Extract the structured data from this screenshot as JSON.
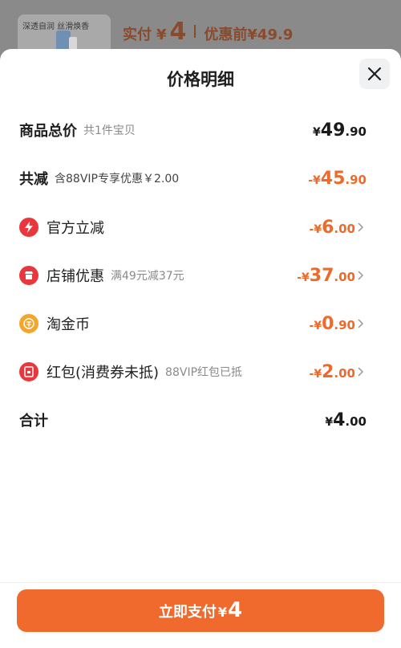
{
  "product": {
    "thumb_caption": "深透自润 丝滑焕香"
  },
  "summary": {
    "paid_label": "实付",
    "currency": "¥",
    "paid_amount": "4",
    "original_label": "优惠前",
    "original_amount": "¥49.9"
  },
  "sheet": {
    "title": "价格明细"
  },
  "rows": [
    {
      "label": "商品总价",
      "sub": "共1件宝贝",
      "amount_prefix": "¥",
      "amount_int": "49",
      "amount_dec": ".90"
    },
    {
      "label": "共减",
      "sub": "含88VIP专享优惠￥2.00",
      "amount_prefix": "-¥",
      "amount_int": "45",
      "amount_dec": ".90"
    },
    {
      "label": "官方立减",
      "sub": "",
      "amount_prefix": "-¥",
      "amount_int": "6",
      "amount_dec": ".00",
      "icon": "lightning-icon",
      "icon_color": "#e8383d"
    },
    {
      "label": "店铺优惠",
      "sub": "满49元减37元",
      "amount_prefix": "-¥",
      "amount_int": "37",
      "amount_dec": ".00",
      "icon": "shop-icon",
      "icon_color": "#e8383d"
    },
    {
      "label": "淘金币",
      "sub": "",
      "amount_prefix": "-¥",
      "amount_int": "0",
      "amount_dec": ".90",
      "icon": "coin-icon",
      "icon_color": "#f4a62a"
    },
    {
      "label": "红包(消费券未抵)",
      "sub": "88VIP红包已抵",
      "amount_prefix": "-¥",
      "amount_int": "2",
      "amount_dec": ".00",
      "icon": "red-packet-icon",
      "icon_color": "#e8383d"
    },
    {
      "label": "合计",
      "sub": "",
      "amount_prefix": "¥",
      "amount_int": "4",
      "amount_dec": ".00"
    }
  ],
  "pay_button": {
    "label": "立即支付",
    "currency": "¥",
    "amount": "4"
  },
  "colors": {
    "accent": "#ef6a2c",
    "discount": "#ee6a2a"
  }
}
